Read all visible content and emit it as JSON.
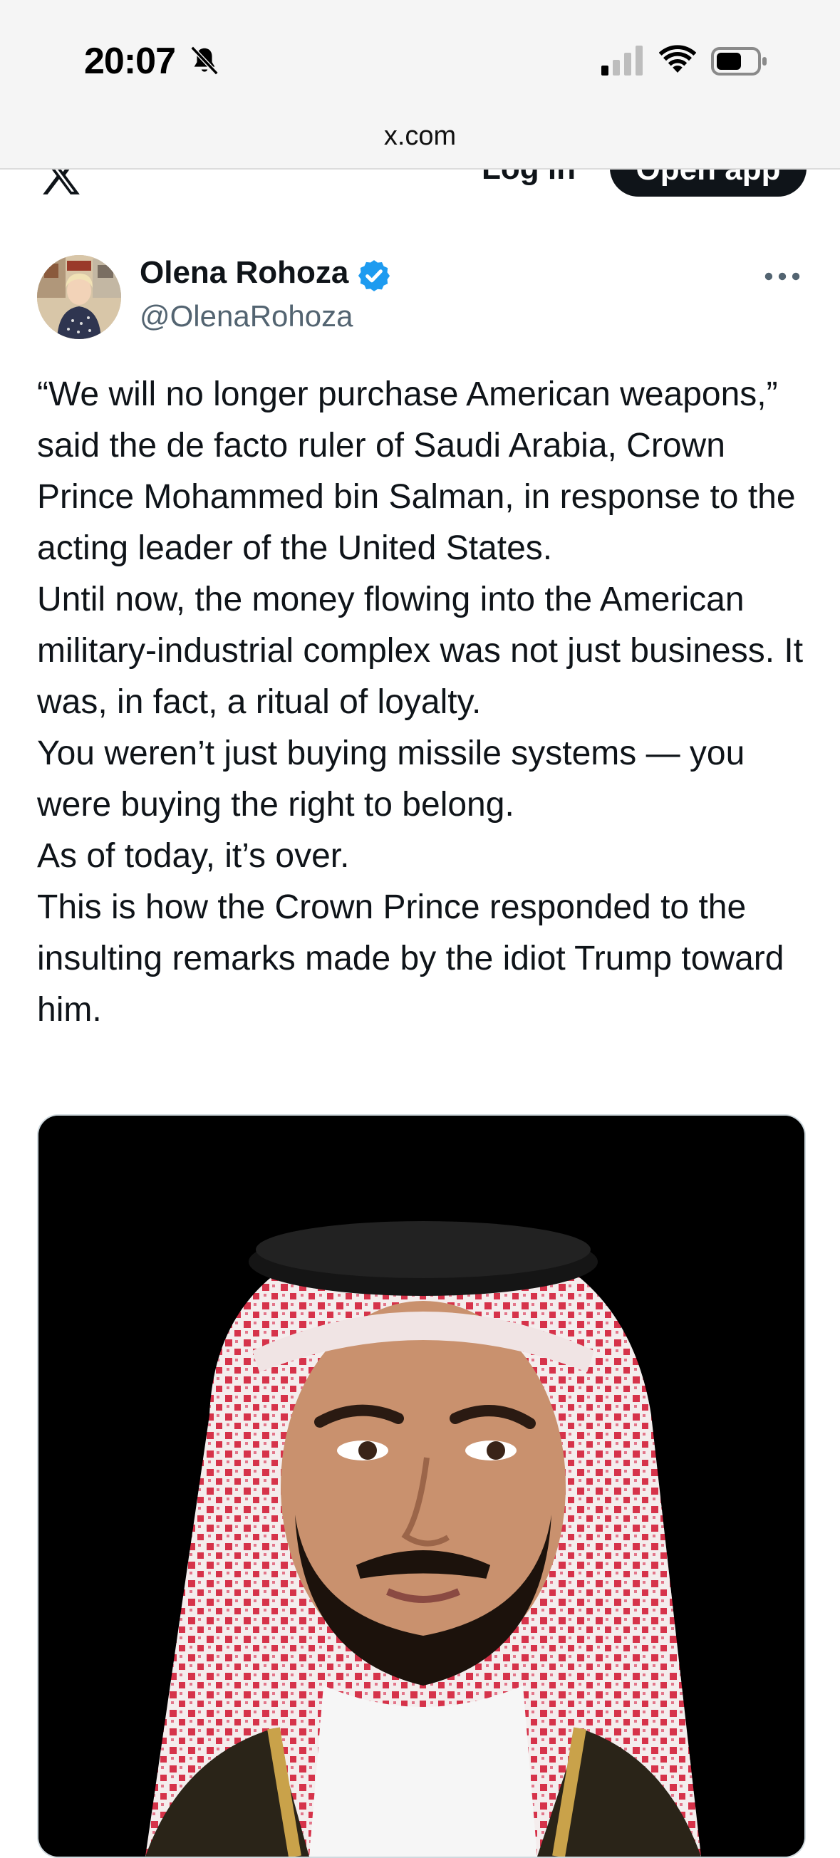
{
  "status_bar": {
    "time": "20:07"
  },
  "browser": {
    "url": "x.com"
  },
  "nav": {
    "login_label": "Log in",
    "open_app_label": "Open app"
  },
  "post": {
    "author_name": "Olena Rohoza",
    "handle": "@OlenaRohoza",
    "paragraphs": [
      "“We will no longer purchase American weapons,” said the de facto ruler of Saudi Arabia, Crown Prince Mohammed bin Salman, in response to the acting leader of the United States.",
      "Until now, the money flowing into the American military-industrial complex was not just business. It was, in fact, a ritual of loyalty.",
      "You weren’t just buying missile systems — you were buying the right to belong.",
      "As of today, it’s over.",
      "This is how the Crown Prince responded to the insulting remarks made by the idiot Trump toward him."
    ]
  },
  "colors": {
    "verified": "#1d9bf0",
    "text": "#0f1419",
    "secondary": "#536471"
  },
  "icons": [
    "bell-slash-icon",
    "cellular-signal-icon",
    "wifi-icon",
    "battery-icon",
    "x-logo-icon",
    "verified-badge-icon",
    "more-icon"
  ]
}
